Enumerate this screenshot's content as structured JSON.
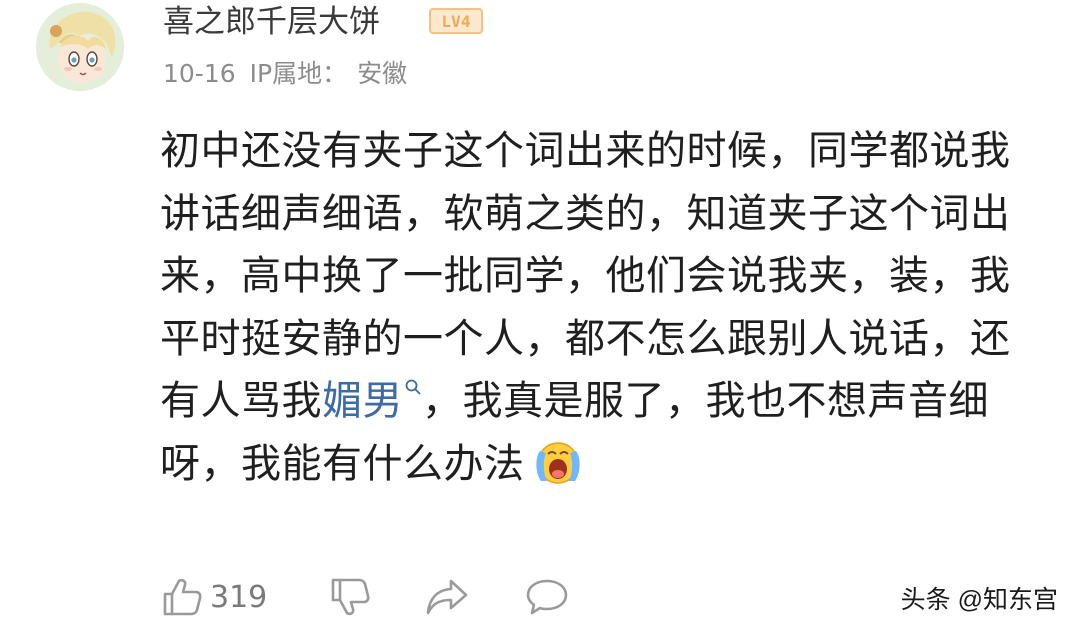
{
  "comment": {
    "author": {
      "username": "喜之郎千层大饼",
      "level_badge": "LV4",
      "avatar": "anime-avatar"
    },
    "meta": {
      "date": "10-16",
      "ip_label": "IP属地：",
      "ip_location": "安徽"
    },
    "body": {
      "line1": "初中还没有夹子这个词出来的时候，同学都说我",
      "line2": "讲话细声细语，软萌之类的，知道夹子这个词出",
      "line3": "来，高中换了一批同学，他们会说我夹，装，我",
      "line4": "平时挺安静的一个人，都不怎么跟别人说话，还",
      "line5_before": "有人骂我",
      "line5_link": "媚男",
      "line5_after": "，我真是服了，我也不想声音细",
      "line6": "呀，我能有什么办法"
    },
    "actions": {
      "like_count": "319",
      "like_icon": "thumbs-up-icon",
      "dislike_icon": "thumbs-down-icon",
      "share_icon": "share-icon",
      "reply_icon": "comment-icon"
    }
  },
  "watermark": "头条 @知东宫",
  "colors": {
    "link": "#3d6ba8",
    "meta": "#8c8c8c",
    "badge": "#f3c27e"
  }
}
